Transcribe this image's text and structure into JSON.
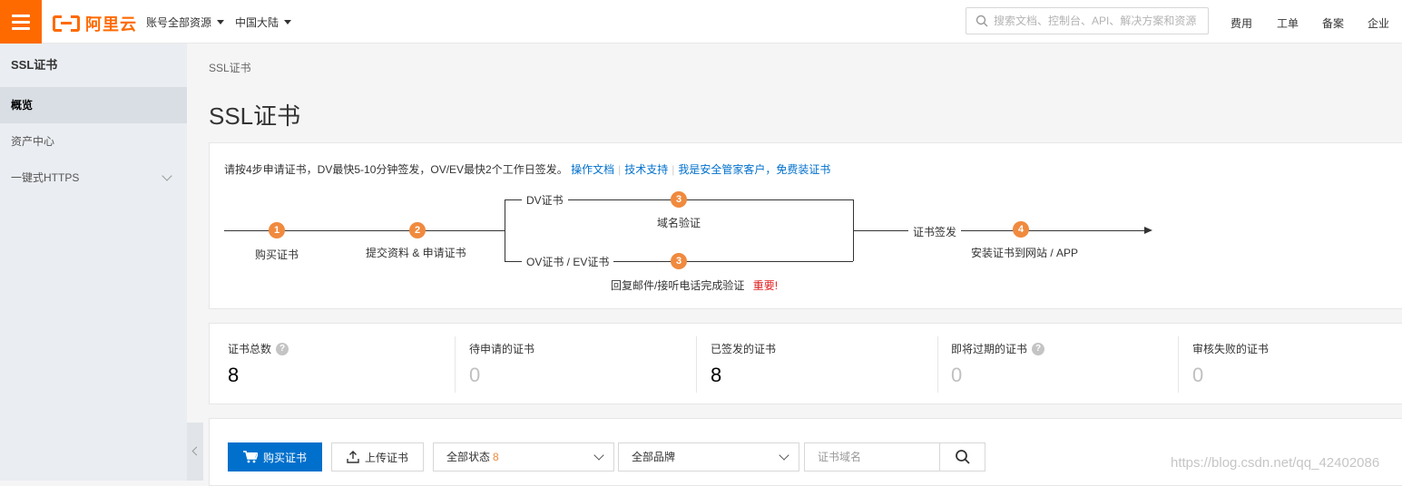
{
  "topbar": {
    "logo_text": "阿里云",
    "account_dropdown": "账号全部资源",
    "region_dropdown": "中国大陆",
    "search_placeholder": "搜索文档、控制台、API、解决方案和资源",
    "links": [
      "费用",
      "工单",
      "备案",
      "企业"
    ],
    "brand_color": "#ff6a00"
  },
  "sidebar": {
    "title": "SSL证书",
    "items": [
      {
        "label": "概览",
        "active": true
      },
      {
        "label": "资产中心",
        "active": false
      },
      {
        "label": "一键式HTTPS",
        "active": false,
        "expandable": true
      }
    ]
  },
  "breadcrumb": "SSL证书",
  "page_title": "SSL证书",
  "steps": {
    "intro": "请按4步申请证书，DV最快5-10分钟签发，OV/EV最快2个工作日签发。",
    "links": [
      "操作文档",
      "技术支持",
      "我是安全管家客户，免费装证书"
    ],
    "step1": {
      "num": "1",
      "label": "购买证书"
    },
    "step2": {
      "num": "2",
      "label": "提交资料 & 申请证书"
    },
    "branch_dv": {
      "title": "DV证书",
      "num": "3",
      "label": "域名验证"
    },
    "branch_ov": {
      "title": "OV证书 / EV证书",
      "num": "3",
      "label": "回复邮件/接听电话完成验证",
      "important": "重要!"
    },
    "issue_label": "证书签发",
    "step4": {
      "num": "4",
      "label": "安装证书到网站 / APP"
    }
  },
  "stats": [
    {
      "label": "证书总数",
      "value": "8",
      "help": true,
      "muted": false
    },
    {
      "label": "待申请的证书",
      "value": "0",
      "help": false,
      "muted": true
    },
    {
      "label": "已签发的证书",
      "value": "8",
      "help": false,
      "muted": false
    },
    {
      "label": "即将过期的证书",
      "value": "0",
      "help": true,
      "muted": true
    },
    {
      "label": "审核失败的证书",
      "value": "0",
      "help": false,
      "muted": true
    }
  ],
  "toolbar": {
    "buy_button": "购买证书",
    "upload_button": "上传证书",
    "status_select": "全部状态",
    "status_count": "8",
    "brand_select": "全部品牌",
    "domain_placeholder": "证书域名"
  },
  "watermark": "https://blog.csdn.net/qq_42402086"
}
